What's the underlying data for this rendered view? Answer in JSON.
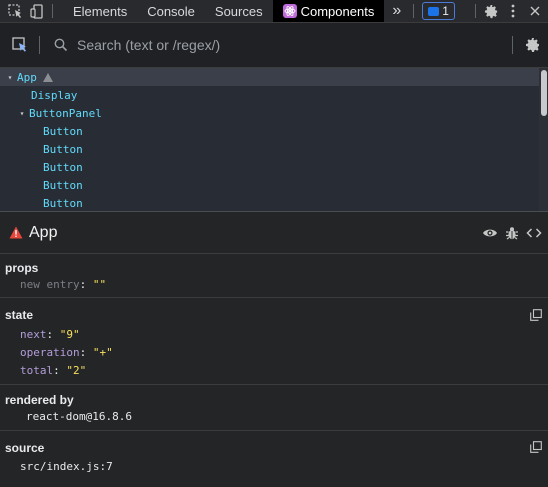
{
  "toolbar": {
    "tabs": [
      "Elements",
      "Console",
      "Sources",
      "Components"
    ],
    "more": "»",
    "badge_count": "1"
  },
  "search": {
    "placeholder": "Search (text or /regex/)"
  },
  "tree": {
    "rows": [
      {
        "label": "App",
        "caret": "▾"
      },
      {
        "label": "Display"
      },
      {
        "label": "ButtonPanel",
        "caret": "▾"
      },
      {
        "label": "Button"
      },
      {
        "label": "Button"
      },
      {
        "label": "Button"
      },
      {
        "label": "Button"
      },
      {
        "label": "Button"
      }
    ]
  },
  "inspected": {
    "title": "App"
  },
  "props": {
    "title": "props",
    "items": [
      {
        "key": "new entry",
        "value": "\"\""
      }
    ]
  },
  "state": {
    "title": "state",
    "items": [
      {
        "key": "next",
        "value": "\"9\""
      },
      {
        "key": "operation",
        "value": "\"+\""
      },
      {
        "key": "total",
        "value": "\"2\""
      }
    ]
  },
  "rendered_by": {
    "title": "rendered by",
    "value": "react-dom@16.8.6"
  },
  "source": {
    "title": "source",
    "value": "src/index.js:7"
  },
  "colors": {
    "component_name": "#61dafb",
    "key": "#b39ddb",
    "string": "#f6e05e",
    "warning": "#e8453c",
    "active_tab": "#000000"
  }
}
